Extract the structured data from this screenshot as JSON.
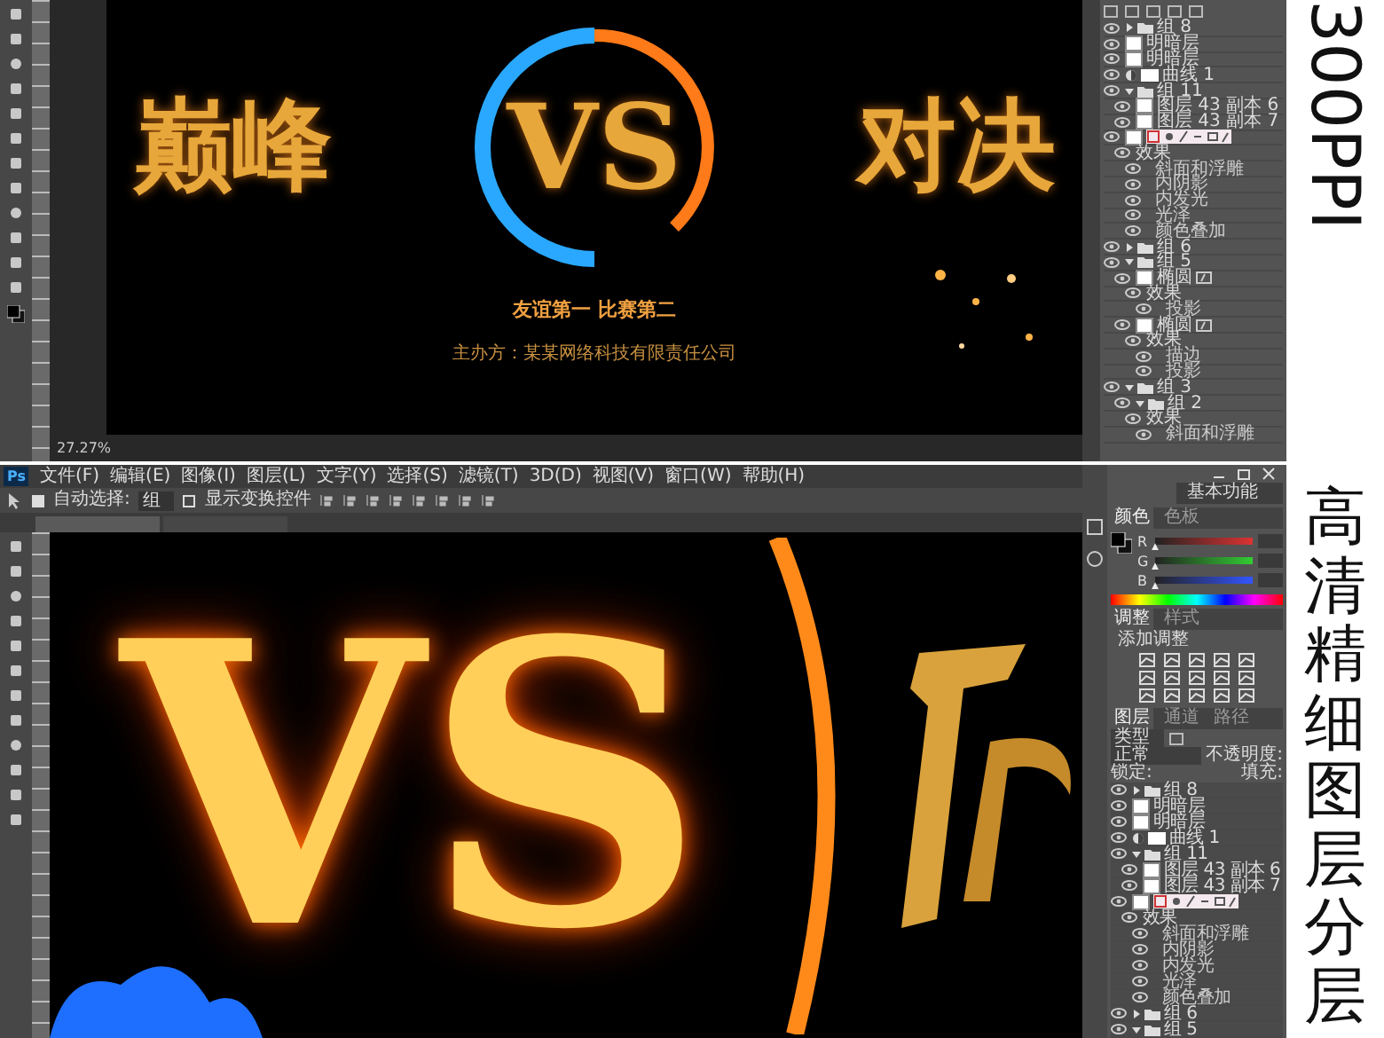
{
  "top_screen": {
    "poster": {
      "title_left": "巅峰",
      "versus": "VS",
      "title_right": "对决",
      "slogan": "友谊第一  比赛第二",
      "organizer": "主办方：某某网络科技有限责任公司"
    },
    "status_zoom": "27.27%",
    "layers": [
      {
        "kind": "group",
        "name": "组 8",
        "expanded": false
      },
      {
        "kind": "layer",
        "name": "明暗层"
      },
      {
        "kind": "layer",
        "name": "明暗层"
      },
      {
        "kind": "adjustment",
        "name": "曲线 1"
      },
      {
        "kind": "group",
        "name": "组 11",
        "expanded": true,
        "children": [
          {
            "kind": "layer",
            "name": "图层 43 副本 6"
          },
          {
            "kind": "layer",
            "name": "图层 43 副本 7"
          }
        ]
      },
      {
        "kind": "styled_layer",
        "children": [
          {
            "kind": "effects",
            "name": "效果",
            "children": [
              {
                "kind": "effect",
                "name": "斜面和浮雕"
              },
              {
                "kind": "effect",
                "name": "内阴影"
              },
              {
                "kind": "effect",
                "name": "内发光"
              },
              {
                "kind": "effect",
                "name": "光泽"
              },
              {
                "kind": "effect",
                "name": "颜色叠加"
              }
            ]
          }
        ]
      },
      {
        "kind": "group",
        "name": "组 6",
        "expanded": false
      },
      {
        "kind": "group",
        "name": "组 5",
        "expanded": true,
        "children": [
          {
            "kind": "shape",
            "name": "椭圆",
            "children": [
              {
                "kind": "effects",
                "name": "效果",
                "children": [
                  {
                    "kind": "effect",
                    "name": "投影"
                  }
                ]
              }
            ]
          },
          {
            "kind": "shape",
            "name": "椭圆",
            "children": [
              {
                "kind": "effects",
                "name": "效果",
                "children": [
                  {
                    "kind": "effect",
                    "name": "描边"
                  },
                  {
                    "kind": "effect",
                    "name": "投影"
                  }
                ]
              }
            ]
          }
        ]
      },
      {
        "kind": "group",
        "name": "组 3",
        "expanded": true,
        "children": [
          {
            "kind": "group",
            "name": "组 2",
            "expanded": true,
            "children": [
              {
                "kind": "effects",
                "name": "效果",
                "children": [
                  {
                    "kind": "effect",
                    "name": "斜面和浮雕"
                  }
                ]
              }
            ]
          }
        ]
      }
    ]
  },
  "bottom_screen": {
    "app_logo": "Ps",
    "menu": [
      "文件(F)",
      "编辑(E)",
      "图像(I)",
      "图层(L)",
      "文字(Y)",
      "选择(S)",
      "滤镜(T)",
      "3D(D)",
      "视图(V)",
      "窗口(W)",
      "帮助(H)"
    ],
    "options": {
      "auto_select": {
        "label": "自动选择:",
        "checked": true
      },
      "target": "组",
      "show_transform": {
        "label": "显示变换控件",
        "checked": false
      }
    },
    "canvas_text": "VS",
    "workspace": "基本功能",
    "color_panel": {
      "tabs": [
        {
          "label": "颜色",
          "selected": true
        },
        {
          "label": "色板",
          "selected": false
        }
      ],
      "channels": [
        {
          "name": "R",
          "level": 0
        },
        {
          "name": "G",
          "level": 0
        },
        {
          "name": "B",
          "level": 0
        }
      ]
    },
    "adjust_panel": {
      "tabs": [
        {
          "label": "调整",
          "selected": true
        },
        {
          "label": "样式",
          "selected": false
        }
      ],
      "title": "添加调整"
    },
    "layers_panel": {
      "tabs": [
        {
          "label": "图层",
          "selected": true
        },
        {
          "label": "通道",
          "selected": false
        },
        {
          "label": "路径",
          "selected": false
        }
      ],
      "filter": "类型",
      "blend_mode": "正常",
      "opacity_label": "不透明度:",
      "lock_label": "锁定:",
      "fill_label": "填充:",
      "layers": [
        {
          "kind": "group",
          "name": "组 8",
          "expanded": false
        },
        {
          "kind": "layer",
          "name": "明暗层"
        },
        {
          "kind": "layer",
          "name": "明暗层"
        },
        {
          "kind": "adjustment",
          "name": "曲线 1"
        },
        {
          "kind": "group",
          "name": "组 11",
          "expanded": true,
          "children": [
            {
              "kind": "layer",
              "name": "图层 43 副本 6"
            },
            {
              "kind": "layer",
              "name": "图层 43 副本 7"
            }
          ]
        },
        {
          "kind": "styled_layer",
          "children": [
            {
              "kind": "effects",
              "name": "效果",
              "children": [
                {
                  "kind": "effect",
                  "name": "斜面和浮雕"
                },
                {
                  "kind": "effect",
                  "name": "内阴影"
                },
                {
                  "kind": "effect",
                  "name": "内发光"
                },
                {
                  "kind": "effect",
                  "name": "光泽"
                },
                {
                  "kind": "effect",
                  "name": "颜色叠加"
                }
              ]
            }
          ]
        },
        {
          "kind": "group",
          "name": "组 6",
          "expanded": false
        },
        {
          "kind": "group",
          "name": "组 5",
          "expanded": true
        }
      ]
    }
  },
  "side_caption": {
    "resolution": "300PPI",
    "title": "高清精细图层分层"
  }
}
